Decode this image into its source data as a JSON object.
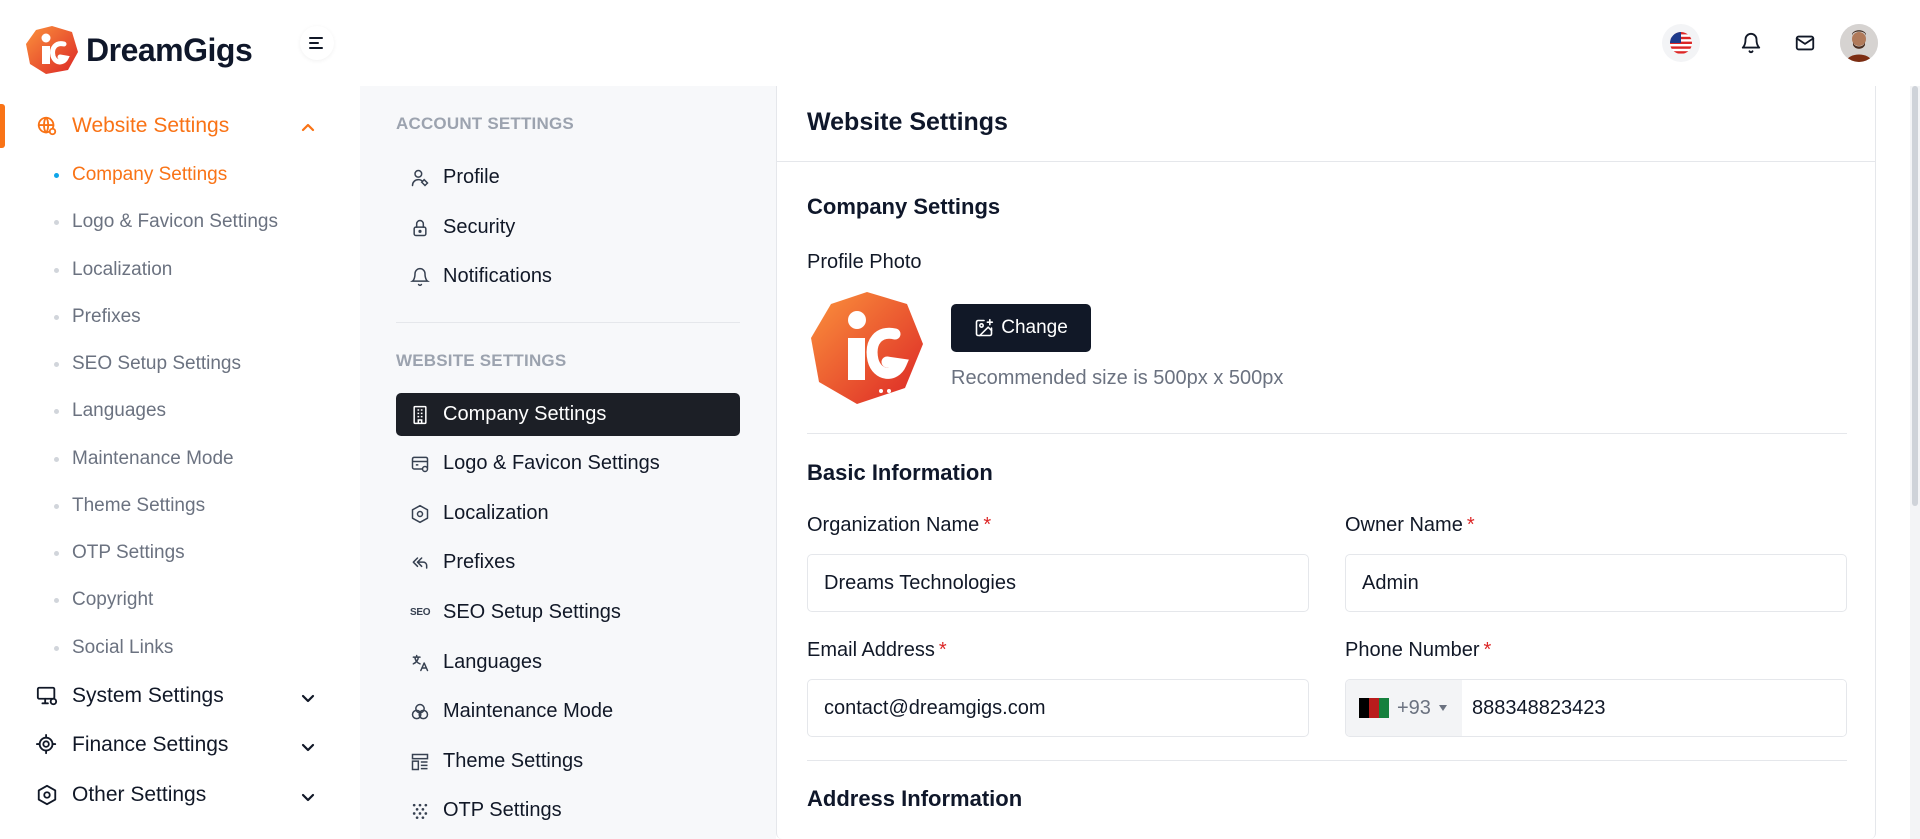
{
  "brand": {
    "name": "DreamGigs",
    "accent": "#f97316"
  },
  "header": {
    "flag_icon": "us-flag-icon",
    "icons": [
      "menu-icon",
      "bell-icon",
      "mail-icon"
    ]
  },
  "sidebar": {
    "parents": [
      {
        "label": "Website Settings",
        "icon": "globe-settings-icon",
        "expanded": true
      },
      {
        "label": "System Settings",
        "icon": "monitor-settings-icon",
        "expanded": false
      },
      {
        "label": "Finance Settings",
        "icon": "coin-settings-icon",
        "expanded": false
      },
      {
        "label": "Other Settings",
        "icon": "hexagon-settings-icon",
        "expanded": false
      }
    ],
    "website_items": [
      "Company Settings",
      "Logo & Favicon Settings",
      "Localization",
      "Prefixes",
      "SEO Setup Settings",
      "Languages",
      "Maintenance Mode",
      "Theme Settings",
      "OTP Settings",
      "Copyright",
      "Social Links"
    ],
    "active_item": "Company Settings"
  },
  "settings_nav": {
    "account_heading": "ACCOUNT SETTINGS",
    "account_items": [
      "Profile",
      "Security",
      "Notifications"
    ],
    "website_heading": "WEBSITE SETTINGS",
    "website_items": [
      "Company Settings",
      "Logo & Favicon Settings",
      "Localization",
      "Prefixes",
      "SEO Setup Settings",
      "Languages",
      "Maintenance Mode",
      "Theme Settings",
      "OTP Settings"
    ],
    "seo_badge": "SEO"
  },
  "main": {
    "title": "Website Settings",
    "company_title": "Company Settings",
    "profile_photo_label": "Profile Photo",
    "change_label": "Change",
    "recommended": "Recommended size is 500px x 500px",
    "basic_title": "Basic Information",
    "fields": {
      "org_label": "Organization Name",
      "org_value": "Dreams Technologies",
      "owner_label": "Owner Name",
      "owner_value": "Admin",
      "email_label": "Email Address",
      "email_value": "contact@dreamgigs.com",
      "phone_label": "Phone Number",
      "phone_code": "+93",
      "phone_value": "888348823423",
      "required_mark": "*"
    },
    "address_title": "Address Information"
  }
}
